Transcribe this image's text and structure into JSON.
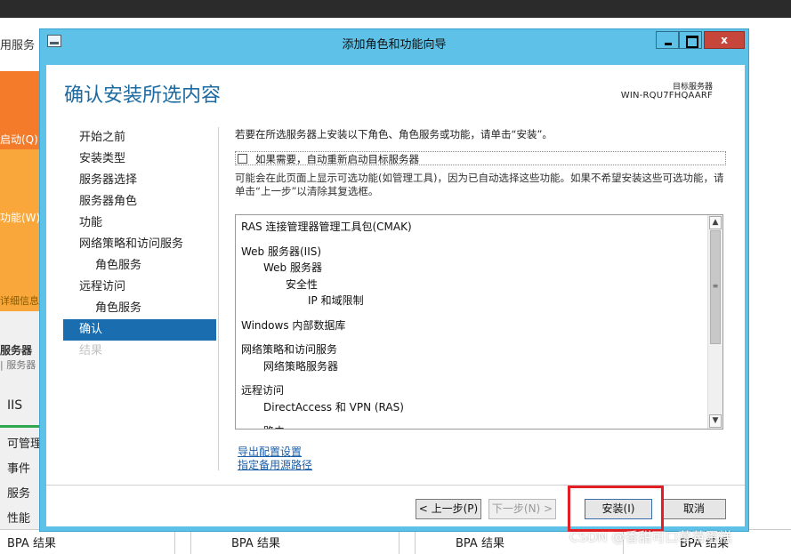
{
  "background": {
    "crumb": "用服务",
    "tiles": [
      "启动(Q)",
      "功能(W)",
      "详细信息("
    ],
    "section_title": "服务器",
    "section_sub": "| 服务器",
    "iis": "IIS",
    "list": [
      "可管理",
      "事件",
      "服务",
      "性能"
    ],
    "bpa": [
      "BPA 结果",
      "BPA 结果",
      "BPA 结果",
      "BPA 结果"
    ]
  },
  "window": {
    "title": "添加角色和功能向导",
    "close_glyph": "x"
  },
  "header": {
    "page_title": "确认安装所选内容",
    "dest_label": "目标服务器",
    "dest_name": "WIN-RQU7FHQAARF"
  },
  "nav": {
    "items": [
      {
        "label": "开始之前"
      },
      {
        "label": "安装类型"
      },
      {
        "label": "服务器选择"
      },
      {
        "label": "服务器角色"
      },
      {
        "label": "功能"
      },
      {
        "label": "网络策略和访问服务"
      },
      {
        "label": "角色服务"
      },
      {
        "label": "远程访问"
      },
      {
        "label": "角色服务"
      },
      {
        "label": "确认"
      },
      {
        "label": "结果"
      }
    ]
  },
  "content": {
    "intro": "若要在所选服务器上安装以下角色、角色服务或功能，请单击“安装”。",
    "restart_label": "如果需要，自动重新启动目标服务器",
    "note": "可能会在此页面上显示可选功能(如管理工具)，因为已自动选择这些功能。如果不希望安装这些可选功能，请单击“上一步”以清除其复选框。",
    "list": [
      "RAS 连接管理器管理工具包(CMAK)",
      "Web 服务器(IIS)",
      "Web 服务器",
      "安全性",
      "IP 和域限制",
      "Windows 内部数据库",
      "网络策略和访问服务",
      "网络策略服务器",
      "远程访问",
      "DirectAccess 和 VPN (RAS)",
      "路由"
    ],
    "links": [
      "导出配置设置",
      "指定备用源路径"
    ]
  },
  "buttons": {
    "prev": "< 上一步(P)",
    "next": "下一步(N) >",
    "install": "安装(I)",
    "cancel": "取消"
  },
  "watermark": "CSDN @香甜可口草莓蛋糕",
  "colors": {
    "title_bar": "#5ec1e7",
    "accent": "#1a6eb0",
    "highlight": "#e41e25"
  }
}
